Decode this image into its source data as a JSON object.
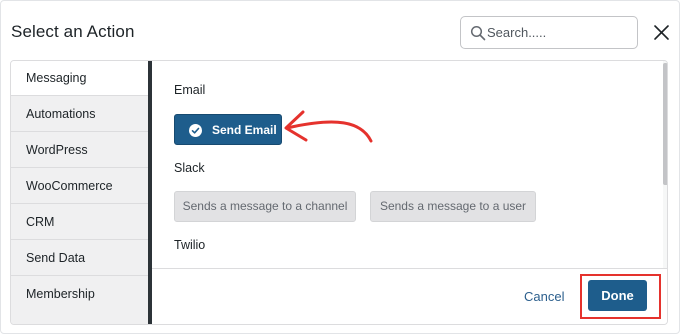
{
  "dialog": {
    "title": "Select an Action",
    "close_icon": "close-icon"
  },
  "search": {
    "placeholder": "Search.....",
    "value": "",
    "icon": "search-icon"
  },
  "sidebar": {
    "items": [
      {
        "label": "Messaging",
        "active": true
      },
      {
        "label": "Automations",
        "active": false
      },
      {
        "label": "WordPress",
        "active": false
      },
      {
        "label": "WooCommerce",
        "active": false
      },
      {
        "label": "CRM",
        "active": false
      },
      {
        "label": "Send Data",
        "active": false
      },
      {
        "label": "Membership",
        "active": false
      }
    ]
  },
  "content": {
    "sections": [
      {
        "label": "Email",
        "actions": [
          {
            "label": "Send Email",
            "selected": true,
            "icon": "check-circle-icon"
          }
        ]
      },
      {
        "label": "Slack",
        "actions": [
          {
            "label": "Sends a message to a channel",
            "selected": false
          },
          {
            "label": "Sends a message to a user",
            "selected": false
          }
        ]
      },
      {
        "label": "Twilio",
        "actions": []
      }
    ]
  },
  "footer": {
    "cancel_label": "Cancel",
    "done_label": "Done"
  },
  "annotation": {
    "arrow_color": "#e5322d",
    "highlight_color": "#e5322d"
  },
  "colors": {
    "primary": "#1e5d8c",
    "sidebar_bg": "#f0f0f1"
  }
}
